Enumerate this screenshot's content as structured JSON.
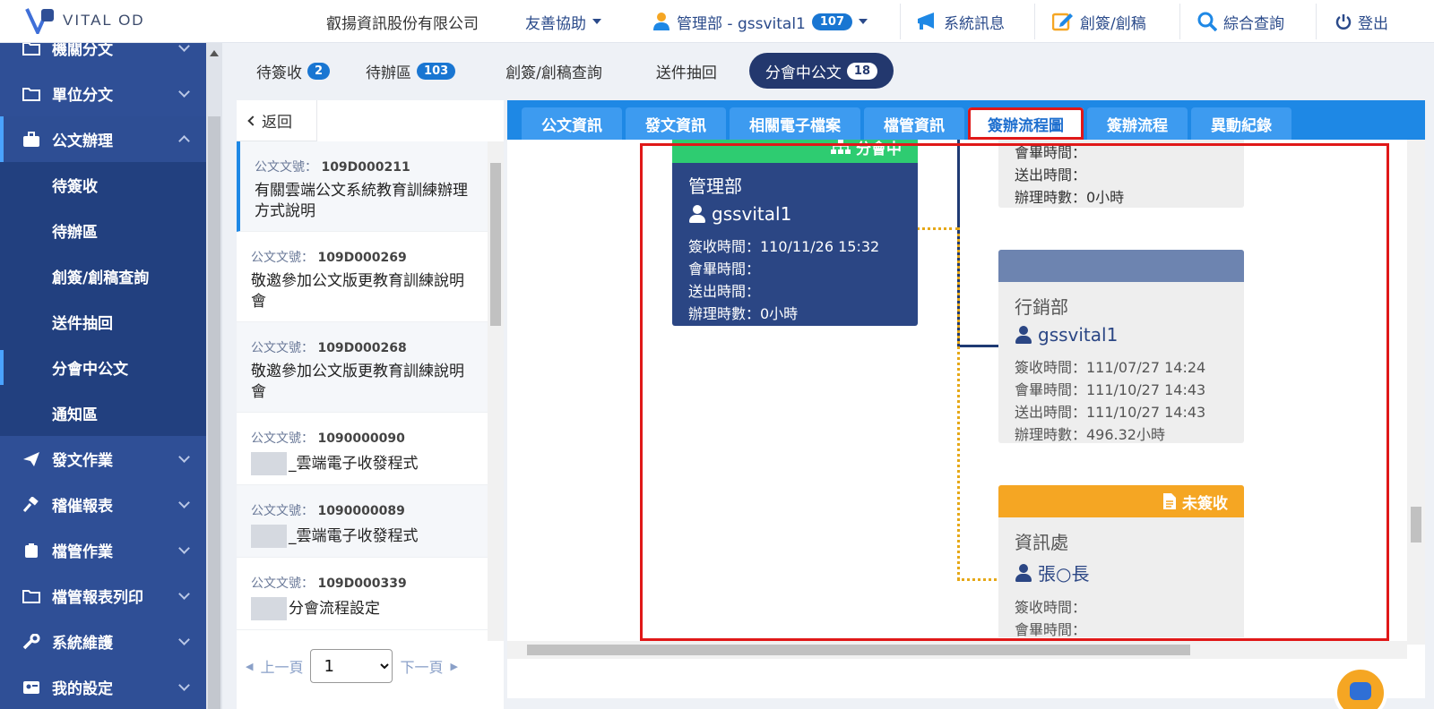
{
  "app": {
    "logo_text": "VITAL OD",
    "company": "叡揚資訊股份有限公司"
  },
  "topnav": {
    "assist": "友善協助",
    "user": "管理部 - gssvital1",
    "user_badge": "107",
    "messages": "系統訊息",
    "compose": "創簽/創稿",
    "search": "綜合查詢",
    "logout": "登出"
  },
  "sidebar": {
    "items": [
      {
        "label": "機關分文"
      },
      {
        "label": "單位分文"
      },
      {
        "label": "公文辦理"
      },
      {
        "label": "發文作業"
      },
      {
        "label": "稽催報表"
      },
      {
        "label": "檔管作業"
      },
      {
        "label": "檔管報表列印"
      },
      {
        "label": "系統維護"
      },
      {
        "label": "我的設定"
      }
    ],
    "sub": [
      {
        "label": "待簽收"
      },
      {
        "label": "待辦區"
      },
      {
        "label": "創簽/創稿查詢"
      },
      {
        "label": "送件抽回"
      },
      {
        "label": "分會中公文"
      },
      {
        "label": "通知區"
      }
    ]
  },
  "tabs": [
    {
      "label": "待簽收",
      "badge": "2"
    },
    {
      "label": "待辦區",
      "badge": "103"
    },
    {
      "label": "創簽/創稿查詢",
      "badge": ""
    },
    {
      "label": "送件抽回",
      "badge": ""
    },
    {
      "label": "分會中公文",
      "badge": "18"
    }
  ],
  "list": {
    "back": "返回",
    "num_label": "公文文號：",
    "items": [
      {
        "num": "109D000211",
        "title": "有關雲端公文系統教育訓練辦理方式說明"
      },
      {
        "num": "109D000269",
        "title": "敬邀參加公文版更教育訓練說明會"
      },
      {
        "num": "109D000268",
        "title": "敬邀參加公文版更教育訓練說明會"
      },
      {
        "num": "1090000090",
        "title": "_雲端電子收發程式"
      },
      {
        "num": "1090000089",
        "title": "_雲端電子收發程式"
      },
      {
        "num": "109D000339",
        "title": "分會流程設定"
      }
    ],
    "pager": {
      "prev": "上一頁",
      "next": "下一頁",
      "page": "1"
    }
  },
  "content_tabs": [
    {
      "label": "公文資訊"
    },
    {
      "label": "發文資訊"
    },
    {
      "label": "相關電子檔案"
    },
    {
      "label": "檔管資訊"
    },
    {
      "label": "簽辦流程圖"
    },
    {
      "label": "簽辦流程"
    },
    {
      "label": "異動紀錄"
    }
  ],
  "flow": {
    "labels": {
      "sign": "簽收時間：",
      "meet": "會畢時間：",
      "send": "送出時間：",
      "hours": "辦理時數："
    },
    "card_top": {
      "meet": "會畢時間：",
      "send": "送出時間：",
      "hours": "辦理時數：0小時"
    },
    "card_main": {
      "status": "分會中",
      "dept": "管理部",
      "user": "gssvital1",
      "sign": "簽收時間：110/11/26 15:32",
      "meet": "會畢時間：",
      "send": "送出時間：",
      "hours": "辦理時數：0小時"
    },
    "card_market": {
      "dept": "行銷部",
      "user": "gssvital1",
      "sign": "簽收時間：111/07/27 14:24",
      "meet": "會畢時間：111/10/27 14:43",
      "send": "送出時間：111/10/27 14:43",
      "hours": "辦理時數：496.32小時"
    },
    "card_info": {
      "status": "未簽收",
      "dept": "資訊處",
      "user": "張○長",
      "sign": "簽收時間：",
      "meet": "會畢時間："
    }
  },
  "colors": {
    "sidebar": "#2f4f96",
    "accent": "#1e88e5",
    "status_green": "#2ecc71",
    "status_orange": "#f5a623",
    "card_navy": "#2b4684",
    "highlight": "#e01818"
  }
}
